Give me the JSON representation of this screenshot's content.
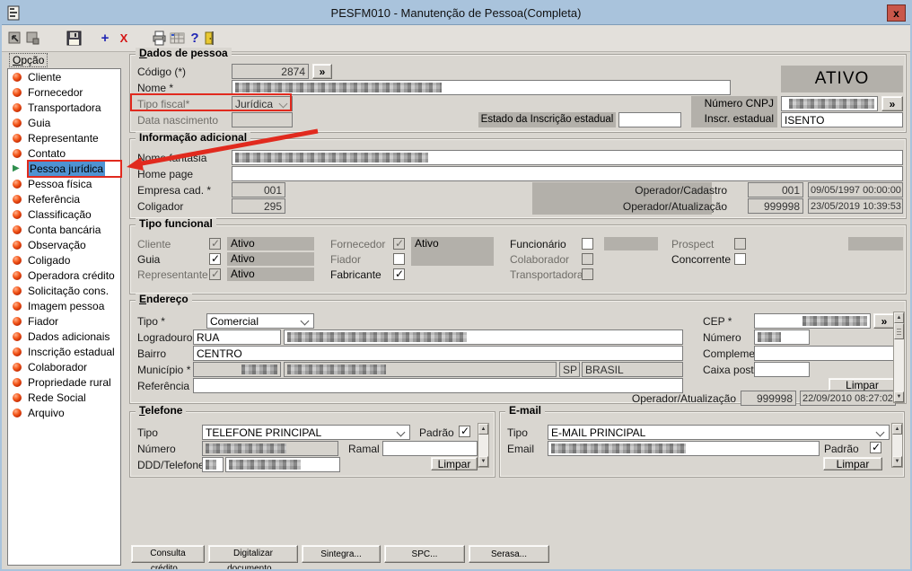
{
  "window": {
    "title": "PESFM010 - Manutenção de Pessoa(Completa)",
    "close_glyph": "x"
  },
  "ui": {
    "lookup_glyph": "»"
  },
  "toolbar": {
    "add_glyph": "+",
    "delete_glyph": "X",
    "help_glyph": "?"
  },
  "sidebar": {
    "label": "Opção",
    "items": [
      {
        "label": "Cliente"
      },
      {
        "label": "Fornecedor"
      },
      {
        "label": "Transportadora"
      },
      {
        "label": "Guia"
      },
      {
        "label": "Representante"
      },
      {
        "label": "Contato"
      },
      {
        "label": "Pessoa jurídica",
        "selected": true
      },
      {
        "label": "Pessoa física"
      },
      {
        "label": "Referência"
      },
      {
        "label": "Classificação"
      },
      {
        "label": "Conta bancária"
      },
      {
        "label": "Observação"
      },
      {
        "label": "Coligado"
      },
      {
        "label": "Operadora crédito"
      },
      {
        "label": "Solicitação cons."
      },
      {
        "label": "Imagem pessoa"
      },
      {
        "label": "Fiador"
      },
      {
        "label": "Dados adicionais"
      },
      {
        "label": "Inscrição estadual"
      },
      {
        "label": "Colaborador"
      },
      {
        "label": "Propriedade rural"
      },
      {
        "label": "Rede Social"
      },
      {
        "label": "Arquivo"
      }
    ]
  },
  "dados_pessoa": {
    "title": "Dados de pessoa",
    "codigo_label": "Código (*)",
    "codigo_value": "2874",
    "nome_label": "Nome *",
    "tipo_fiscal_label": "Tipo fiscal*",
    "tipo_fiscal_value": "Jurídica",
    "data_nascimento_label": "Data nascimento",
    "estado_ie_label": "Estado da Inscrição estadual",
    "status": "ATIVO",
    "cnpj_label": "Número CNPJ",
    "ie_label": "Inscr. estadual",
    "ie_value": "ISENTO"
  },
  "info_adicional": {
    "title": "Informação adicional",
    "nome_fantasia_label": "Nome fantasia",
    "home_page_label": "Home page",
    "empresa_label": "Empresa cad. *",
    "empresa_value": "001",
    "coligador_label": "Coligador",
    "coligador_value": "295",
    "op_cadastro_label": "Operador/Cadastro",
    "op_cadastro_value": "001",
    "op_cadastro_date": "09/05/1997 00:00:00",
    "op_atualizacao_label": "Operador/Atualização",
    "op_atualizacao_value": "999998",
    "op_atualizacao_date": "23/05/2019 10:39:53"
  },
  "tipo_funcional": {
    "title": "Tipo funcional",
    "status_label": "Ativo",
    "columns": [
      {
        "items": [
          {
            "label": "Cliente",
            "checked": true,
            "dim_label": true,
            "gray_box": true
          },
          {
            "label": "Guia",
            "checked": true,
            "dim_label": false,
            "gray_box": false
          },
          {
            "label": "Representante",
            "checked": true,
            "dim_label": true,
            "gray_box": true
          }
        ]
      },
      {
        "items": [
          {
            "label": "Fornecedor",
            "checked": true,
            "dim_label": true,
            "gray_box": true
          },
          {
            "label": "Fiador",
            "checked": false,
            "dim_label": true,
            "gray_box": false
          },
          {
            "label": "Fabricante",
            "checked": true,
            "dim_label": false,
            "gray_box": false
          }
        ]
      },
      {
        "items": [
          {
            "label": "Funcionário",
            "checked": false,
            "dim_label": false,
            "gray_box": false
          },
          {
            "label": "Colaborador",
            "checked": false,
            "dim_label": true,
            "gray_box": true
          },
          {
            "label": "Transportadora",
            "checked": false,
            "dim_label": true,
            "gray_box": true
          }
        ]
      },
      {
        "items": [
          {
            "label": "Prospect",
            "checked": false,
            "dim_label": true,
            "gray_box": true
          },
          {
            "label": "Concorrente",
            "checked": false,
            "dim_label": false,
            "gray_box": false
          }
        ]
      }
    ]
  },
  "endereco": {
    "title": "Endereço",
    "tipo_label": "Tipo *",
    "tipo_value": "Comercial",
    "logradouro_label": "Logradouro *",
    "logradouro_tipo": "RUA",
    "bairro_label": "Bairro",
    "bairro_value": "CENTRO",
    "municipio_label": "Município *",
    "uf_value": "SP",
    "pais_value": "BRASIL",
    "referencia_label": "Referência",
    "cep_label": "CEP *",
    "numero_label": "Número",
    "complemento_label": "Complemento",
    "caixa_postal_label": "Caixa postal",
    "limpar_label": "Limpar",
    "op_atualizacao_label": "Operador/Atualização",
    "op_value": "999998",
    "op_date": "22/09/2010 08:27:02"
  },
  "telefone": {
    "title": "Telefone",
    "tipo_label": "Tipo",
    "tipo_value": "TELEFONE PRINCIPAL",
    "padrao_label": "Padrão",
    "numero_label": "Número",
    "ramal_label": "Ramal",
    "ddd_label": "DDD/Telefone",
    "limpar_label": "Limpar"
  },
  "email": {
    "title": "E-mail",
    "tipo_label": "Tipo",
    "tipo_value": "E-MAIL PRINCIPAL",
    "email_label": "Email",
    "padrao_label": "Padrão",
    "limpar_label": "Limpar"
  },
  "footer": {
    "buttons": [
      "Consulta crédito...",
      "Digitalizar documento...",
      "Sintegra...",
      "SPC...",
      "Serasa..."
    ]
  }
}
